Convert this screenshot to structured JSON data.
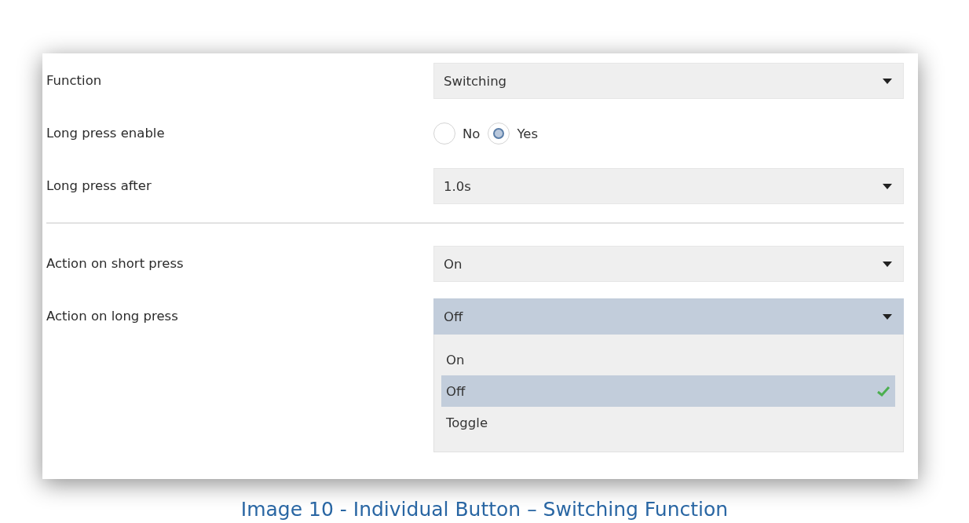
{
  "groups": [
    {
      "rows": [
        {
          "kind": "select",
          "label": "Function",
          "value": "Switching",
          "open": false
        },
        {
          "kind": "radio",
          "label": "Long press enable",
          "options": [
            {
              "label": "No",
              "selected": false
            },
            {
              "label": "Yes",
              "selected": true
            }
          ]
        },
        {
          "kind": "select",
          "label": "Long press after",
          "value": "1.0s",
          "open": false
        }
      ]
    },
    {
      "rows": [
        {
          "kind": "select",
          "label": "Action on short press",
          "value": "On",
          "open": false
        },
        {
          "kind": "select",
          "label": "Action on long press",
          "value": "Off",
          "open": true,
          "options": [
            {
              "label": "On",
              "selected": false
            },
            {
              "label": "Off",
              "selected": true
            },
            {
              "label": "Toggle",
              "selected": false
            }
          ]
        }
      ]
    }
  ],
  "caption": "Image 10 - Individual Button – Switching Function"
}
